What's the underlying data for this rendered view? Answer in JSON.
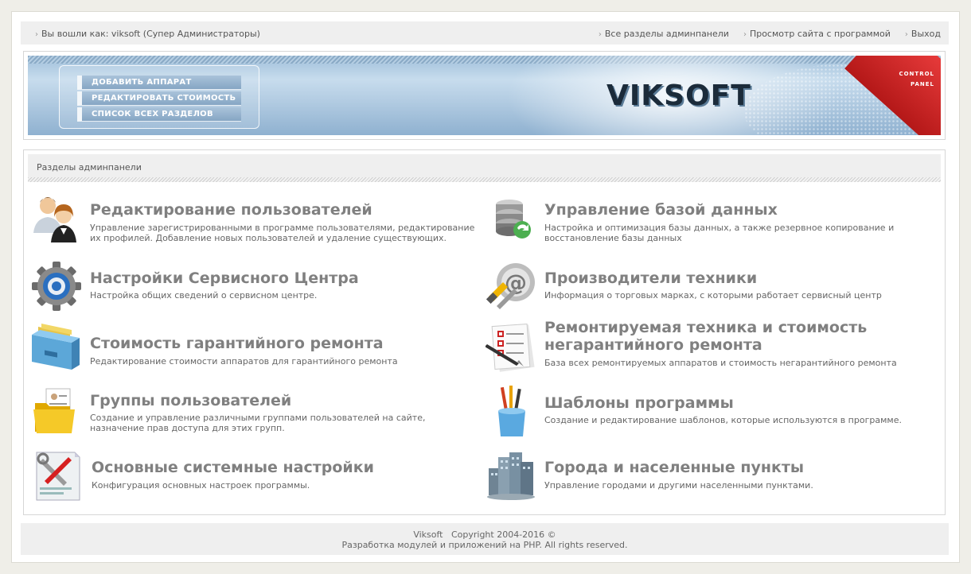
{
  "topbar": {
    "logged_in": "Вы вошли как: viksoft (Супер Администраторы)",
    "links": [
      "Все разделы админпанели",
      "Просмотр сайта с программой",
      "Выход"
    ]
  },
  "banner": {
    "menu": [
      "ДОБАВИТЬ АППАРАТ",
      "РЕДАКТИРОВАТЬ СТОИМОСТЬ",
      "СПИСОК ВСЕХ РАЗДЕЛОВ"
    ],
    "logo": "VIKSOFT",
    "corner_line1": "CONTROL",
    "corner_line2": "PANEL"
  },
  "sections": {
    "header": "Разделы админпанели",
    "items": [
      {
        "icon": "users-icon",
        "title": "Редактирование пользователей",
        "desc": "Управление зарегистрированными в программе пользователями, редактирование их профилей. Добавление новых пользователей и удаление существующих."
      },
      {
        "icon": "database-icon",
        "title": "Управление базой данных",
        "desc": "Настройка и оптимизация базы данных, а также резервное копирование и восстановление базы данных"
      },
      {
        "icon": "gear-icon",
        "title": "Настройки Сервисного Центра",
        "desc": "Настройка общих сведений о сервисном центре."
      },
      {
        "icon": "manufacturers-icon",
        "title": "Производители техники",
        "desc": "Информация о торговых марках, с которыми работает сервисный центр"
      },
      {
        "icon": "file-cabinet-icon",
        "title": "Стоимость гарантийного ремонта",
        "desc": "Редактирование стоимости аппаратов для гарантийного ремонта"
      },
      {
        "icon": "checklist-icon",
        "title": "Ремонтируемая техника и стоимость негарантийного ремонта",
        "desc": "База всех ремонтируемых аппаратов и стоимость негарантийного ремонта"
      },
      {
        "icon": "folder-icon",
        "title": "Группы пользователей",
        "desc": "Создание и управление различными группами пользователей на сайте, назначение прав доступа для этих групп."
      },
      {
        "icon": "brushes-icon",
        "title": "Шаблоны программы",
        "desc": "Создание и редактирование шаблонов, которые используются в программе."
      },
      {
        "icon": "tools-icon",
        "title": "Основные системные настройки",
        "desc": "Конфигурация основных настроек программы."
      },
      {
        "icon": "city-icon",
        "title": "Города и населенные пункты",
        "desc": "Управление городами и другими населенными пунктами."
      }
    ]
  },
  "footer": {
    "line1": "Viksoft   Copyright 2004-2016 ©",
    "line2": "Разработка модулей и приложений на PHP. All rights reserved."
  }
}
